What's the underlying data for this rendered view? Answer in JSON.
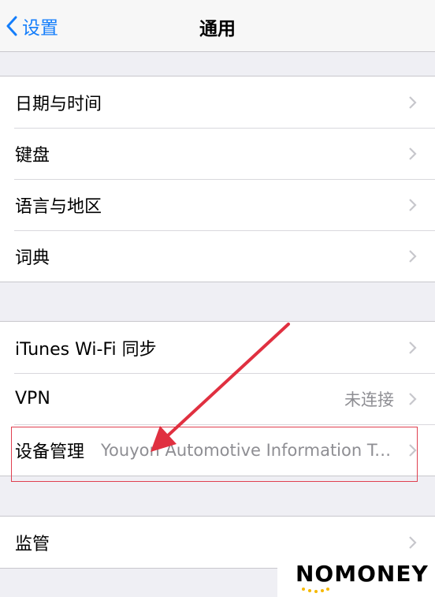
{
  "nav": {
    "back_label": "设置",
    "title": "通用"
  },
  "groups": [
    {
      "items": [
        {
          "label": "日期与时间"
        },
        {
          "label": "键盘"
        },
        {
          "label": "语言与地区"
        },
        {
          "label": "词典"
        }
      ]
    },
    {
      "items": [
        {
          "label": "iTunes Wi-Fi 同步"
        },
        {
          "label": "VPN",
          "detail": "未连接"
        },
        {
          "label": "设备管理",
          "detail": "Youyon Automotive Information Technology Co., Ltd."
        }
      ]
    },
    {
      "items": [
        {
          "label": "监管"
        }
      ]
    }
  ],
  "watermark": {
    "text": "NOMONEY"
  },
  "colors": {
    "accent": "#147efb",
    "annotation": "#e03040",
    "background": "#efeff4"
  }
}
